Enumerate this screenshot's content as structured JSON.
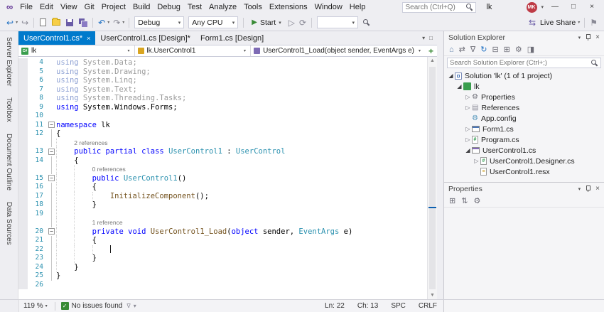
{
  "colors": {
    "accent": "#007ACC",
    "keyword": "#0000FF",
    "type": "#2B91AF",
    "method": "#74531F",
    "line_number": "#2B91AF",
    "health_green": "#388A34",
    "avatar_red": "#BE3B46"
  },
  "menu": {
    "items": [
      "File",
      "Edit",
      "View",
      "Git",
      "Project",
      "Build",
      "Debug",
      "Test",
      "Analyze",
      "Tools",
      "Extensions",
      "Window",
      "Help"
    ],
    "search_placeholder": "Search (Ctrl+Q)",
    "title": "lk",
    "avatar": "MK",
    "minimize": "—",
    "maximize": "□",
    "close": "×"
  },
  "toolbar": {
    "debug_config": "Debug",
    "platform": "Any CPU",
    "start": "Start",
    "find_combo": "",
    "live_share": "Live Share"
  },
  "tabs": [
    {
      "label": "UserControl1.cs*",
      "active": true
    },
    {
      "label": "UserControl1.cs [Design]*",
      "active": false
    },
    {
      "label": "Form1.cs [Design]",
      "active": false
    }
  ],
  "breadcrumb": {
    "project": "lk",
    "type": "lk.UserControl1",
    "member": "UserControl1_Load(object sender, EventArgs e)"
  },
  "left_tabs": [
    "Server Explorer",
    "Toolbox",
    "Document Outline",
    "Data Sources"
  ],
  "editor": {
    "rows": [
      {
        "n": 4,
        "ind": 0,
        "fold": "",
        "seg": [
          [
            "kf",
            "using"
          ],
          [
            "pf",
            " System.Data;"
          ]
        ]
      },
      {
        "n": 5,
        "ind": 0,
        "fold": "",
        "seg": [
          [
            "kf",
            "using"
          ],
          [
            "pf",
            " System.Drawing;"
          ]
        ]
      },
      {
        "n": 6,
        "ind": 0,
        "fold": "",
        "seg": [
          [
            "kf",
            "using"
          ],
          [
            "pf",
            " System.Linq;"
          ]
        ]
      },
      {
        "n": 7,
        "ind": 0,
        "fold": "",
        "seg": [
          [
            "kf",
            "using"
          ],
          [
            "pf",
            " System.Text;"
          ]
        ]
      },
      {
        "n": 8,
        "ind": 0,
        "fold": "",
        "seg": [
          [
            "kf",
            "using"
          ],
          [
            "pf",
            " System.Threading.Tasks;"
          ]
        ]
      },
      {
        "n": 9,
        "ind": 0,
        "fold": "",
        "seg": [
          [
            "k",
            "using"
          ],
          [
            "p",
            " System.Windows.Forms;"
          ]
        ]
      },
      {
        "n": 10,
        "ind": 0,
        "fold": "",
        "seg": []
      },
      {
        "n": 11,
        "ind": 0,
        "fold": "box",
        "seg": [
          [
            "k",
            "namespace"
          ],
          [
            "p",
            " lk"
          ]
        ]
      },
      {
        "n": 12,
        "ind": 0,
        "fold": "line",
        "seg": [
          [
            "p",
            "{"
          ]
        ]
      },
      {
        "cl": "2 references",
        "ind": 1,
        "fold": "line"
      },
      {
        "n": 13,
        "ind": 1,
        "fold": "box",
        "seg": [
          [
            "k",
            "public"
          ],
          [
            "p",
            " "
          ],
          [
            "k",
            "partial"
          ],
          [
            "p",
            " "
          ],
          [
            "k",
            "class"
          ],
          [
            "p",
            " "
          ],
          [
            "t",
            "UserControl1"
          ],
          [
            "p",
            " : "
          ],
          [
            "t",
            "UserControl"
          ]
        ]
      },
      {
        "n": 14,
        "ind": 1,
        "fold": "line",
        "seg": [
          [
            "p",
            "{"
          ]
        ]
      },
      {
        "cl": "0 references",
        "ind": 2,
        "fold": "line"
      },
      {
        "n": 15,
        "ind": 2,
        "fold": "box",
        "seg": [
          [
            "k",
            "public"
          ],
          [
            "p",
            " "
          ],
          [
            "t",
            "UserControl1"
          ],
          [
            "p",
            "()"
          ]
        ]
      },
      {
        "n": 16,
        "ind": 2,
        "fold": "line",
        "seg": [
          [
            "p",
            "{"
          ]
        ]
      },
      {
        "n": 17,
        "ind": 3,
        "fold": "line",
        "seg": [
          [
            "m",
            "InitializeComponent"
          ],
          [
            "p",
            "();"
          ]
        ]
      },
      {
        "n": 18,
        "ind": 2,
        "fold": "line",
        "seg": [
          [
            "p",
            "}"
          ]
        ]
      },
      {
        "n": 19,
        "ind": 2,
        "fold": "line",
        "seg": []
      },
      {
        "cl": "1 reference",
        "ind": 2,
        "fold": "line"
      },
      {
        "n": 20,
        "ind": 2,
        "fold": "box",
        "seg": [
          [
            "k",
            "private"
          ],
          [
            "p",
            " "
          ],
          [
            "k",
            "void"
          ],
          [
            "p",
            " "
          ],
          [
            "m",
            "UserControl1_Load"
          ],
          [
            "p",
            "("
          ],
          [
            "k",
            "object"
          ],
          [
            "p",
            " sender, "
          ],
          [
            "t",
            "EventArgs"
          ],
          [
            "p",
            " e)"
          ]
        ]
      },
      {
        "n": 21,
        "ind": 2,
        "fold": "line",
        "seg": [
          [
            "p",
            "{"
          ]
        ]
      },
      {
        "n": 22,
        "ind": 3,
        "fold": "line",
        "caret": true,
        "seg": []
      },
      {
        "n": 23,
        "ind": 2,
        "fold": "line",
        "seg": [
          [
            "p",
            "}"
          ]
        ]
      },
      {
        "n": 24,
        "ind": 1,
        "fold": "line",
        "seg": [
          [
            "p",
            "}"
          ]
        ]
      },
      {
        "n": 25,
        "ind": 0,
        "fold": "line",
        "seg": [
          [
            "p",
            "}"
          ]
        ]
      },
      {
        "n": 26,
        "ind": 0,
        "fold": "",
        "seg": []
      }
    ]
  },
  "solution_explorer": {
    "title": "Solution Explorer",
    "search_placeholder": "Search Solution Explorer (Ctrl+;)",
    "toolbar": [
      {
        "name": "home-icon",
        "glyph": "⌂",
        "color": "#5B7DA8"
      },
      {
        "name": "switch-views-icon",
        "glyph": "⇄",
        "color": "#6E6E78"
      },
      {
        "name": "pending-changes-filter-icon",
        "glyph": "∇",
        "color": "#6E6E78"
      },
      {
        "name": "refresh-icon",
        "glyph": "↻",
        "color": "#1B6EC2"
      },
      {
        "name": "collapse-all-icon",
        "glyph": "⊟",
        "color": "#6E6E78"
      },
      {
        "name": "show-all-files-icon",
        "glyph": "⊞",
        "color": "#6E6E78"
      },
      {
        "name": "properties-icon",
        "glyph": "⚙",
        "color": "#6E6E78"
      },
      {
        "name": "preview-selected-icon",
        "glyph": "◨",
        "color": "#6E6E78"
      }
    ],
    "tree": [
      {
        "label": "Solution 'lk' (1 of 1 project)",
        "level": 0,
        "exp": "open",
        "icon": "solution"
      },
      {
        "label": "lk",
        "level": 1,
        "exp": "open",
        "icon": "csproj"
      },
      {
        "label": "Properties",
        "level": 2,
        "exp": "closed",
        "icon": "wrench"
      },
      {
        "label": "References",
        "level": 2,
        "exp": "closed",
        "icon": "reference"
      },
      {
        "label": "App.config",
        "level": 2,
        "exp": null,
        "icon": "gear"
      },
      {
        "label": "Form1.cs",
        "level": 2,
        "exp": "closed",
        "icon": "form"
      },
      {
        "label": "Program.cs",
        "level": 2,
        "exp": "closed",
        "icon": "csfile"
      },
      {
        "label": "UserControl1.cs",
        "level": 2,
        "exp": "open",
        "icon": "usercontrol"
      },
      {
        "label": "UserControl1.Designer.cs",
        "level": 3,
        "exp": "closed",
        "icon": "csfile"
      },
      {
        "label": "UserControl1.resx",
        "level": 3,
        "exp": null,
        "icon": "resx"
      }
    ]
  },
  "properties": {
    "title": "Properties",
    "toolbar": [
      {
        "name": "categorized-icon",
        "glyph": "⊞",
        "color": "#6E6E78"
      },
      {
        "name": "alphabetical-icon",
        "glyph": "⇅",
        "color": "#6E6E78"
      },
      {
        "name": "property-pages-icon",
        "glyph": "⚙",
        "color": "#6E6E78"
      }
    ]
  },
  "status": {
    "zoom": "119 %",
    "health": "No issues found",
    "ln": "Ln: 22",
    "ch": "Ch: 13",
    "spc": "SPC",
    "eol": "CRLF"
  }
}
